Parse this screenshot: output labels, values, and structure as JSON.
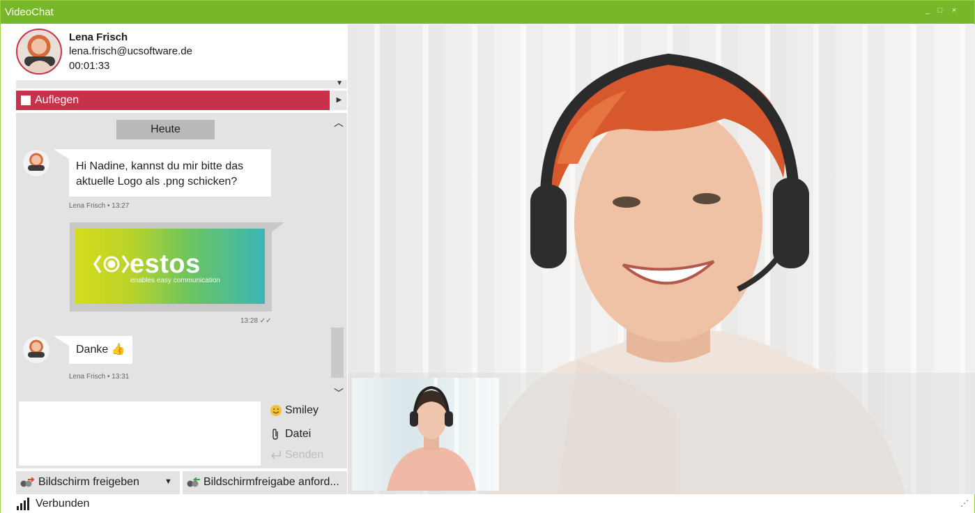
{
  "window": {
    "title": "VideoChat",
    "controls": [
      "_",
      "□",
      "×"
    ]
  },
  "contact": {
    "name": "Lena Frisch",
    "email": "lena.frisch@ucsoftware.de",
    "duration": "00:01:33"
  },
  "call": {
    "hangup_label": "Auflegen"
  },
  "chat": {
    "day_separator": "Heute",
    "messages": [
      {
        "text_line1": "Hi Nadine, kannst du mir bitte das",
        "text_line2": "aktuelle Logo als .png schicken?",
        "meta": "Lena Frisch • 13:27"
      },
      {
        "image_logo_text": "estos",
        "image_logo_tagline": "enables easy communication",
        "meta": "13:28 ✓✓"
      },
      {
        "text": "Danke 👍",
        "meta": "Lena Frisch • 13:31"
      }
    ]
  },
  "compose": {
    "input_value": "",
    "smiley_label": "Smiley",
    "file_label": "Datei",
    "send_label": "Senden"
  },
  "share": {
    "share_label": "Bildschirm freigeben",
    "request_label": "Bildschirmfreigabe anford..."
  },
  "status": {
    "connection": "Verbunden"
  },
  "colors": {
    "titlebar": "#76b82a",
    "hangup": "#c8314a",
    "chat_bg": "#e3e3e3"
  }
}
